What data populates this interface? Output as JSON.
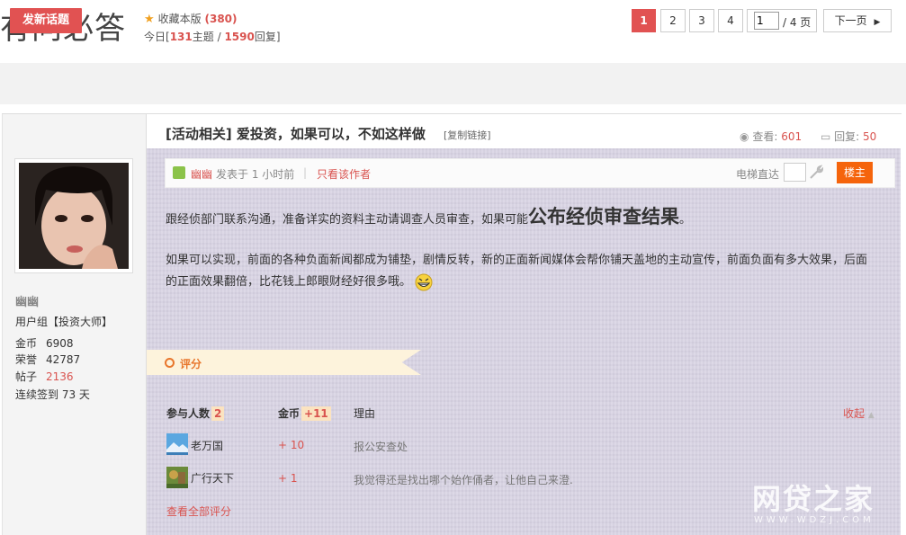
{
  "header": {
    "board_title": "有问必答",
    "fav_label": "收藏本版",
    "fav_count": "(380)",
    "today_prefix": "今日[",
    "today_topics": "131",
    "today_topics_suffix": "主题 / ",
    "today_replies": "1590",
    "today_replies_suffix": "回复]"
  },
  "toolbar": {
    "new_topic": "发新话题",
    "pages": [
      "1",
      "2",
      "3",
      "4"
    ],
    "current_page": "1",
    "page_total": "/ 4 页",
    "next_page": "下一页"
  },
  "author": {
    "name": "幽幽",
    "group": "用户组【投资大师】",
    "stats": [
      {
        "label": "金币",
        "value": "6908"
      },
      {
        "label": "荣誉",
        "value": "42787"
      },
      {
        "label": "帖子",
        "value": "2136"
      }
    ],
    "checkin": "连续签到 73 天"
  },
  "thread": {
    "title": "[活动相关] 爱投资，如果可以，不如这样做",
    "copy_link": "[复制链接]",
    "views_label": "查看:",
    "views": "601",
    "replies_label": "回复:",
    "replies": "50"
  },
  "post_info": {
    "poster": "幽幽",
    "time": "发表于 1 小时前",
    "separator": "|",
    "only_author": "只看该作者",
    "jump_label": "电梯直达",
    "floor": "楼主"
  },
  "content": {
    "para1_text": "跟经侦部门联系沟通，准备详实的资料主动请调查人员审查，如果可能",
    "para1_big": "公布经侦审查结果",
    "para1_end": "。",
    "para2": "如果可以实现，前面的各种负面新闻都成为铺垫，剧情反转，新的正面新闻媒体会帮你铺天盖地的主动宣传，前面负面有多大效果，后面的正面效果翻倍，比花钱上郎眼财经好很多哦。"
  },
  "rating": {
    "tab_label": "评分",
    "participants_label": "参与人数",
    "participants": "2",
    "coins_label": "金币",
    "coins_total": "+11",
    "reason_label": "理由",
    "collapse": "收起",
    "rows": [
      {
        "name": "老万国",
        "coins": "+ 10",
        "reason": "报公安查处"
      },
      {
        "name": "广行天下",
        "coins": "+ 1",
        "reason": "我觉得还是找出哪个始作俑者，让他自己来澄."
      }
    ],
    "view_all": "查看全部评分"
  },
  "watermark": {
    "text": "网贷之家",
    "url": "WWW.WDZJ.COM"
  }
}
